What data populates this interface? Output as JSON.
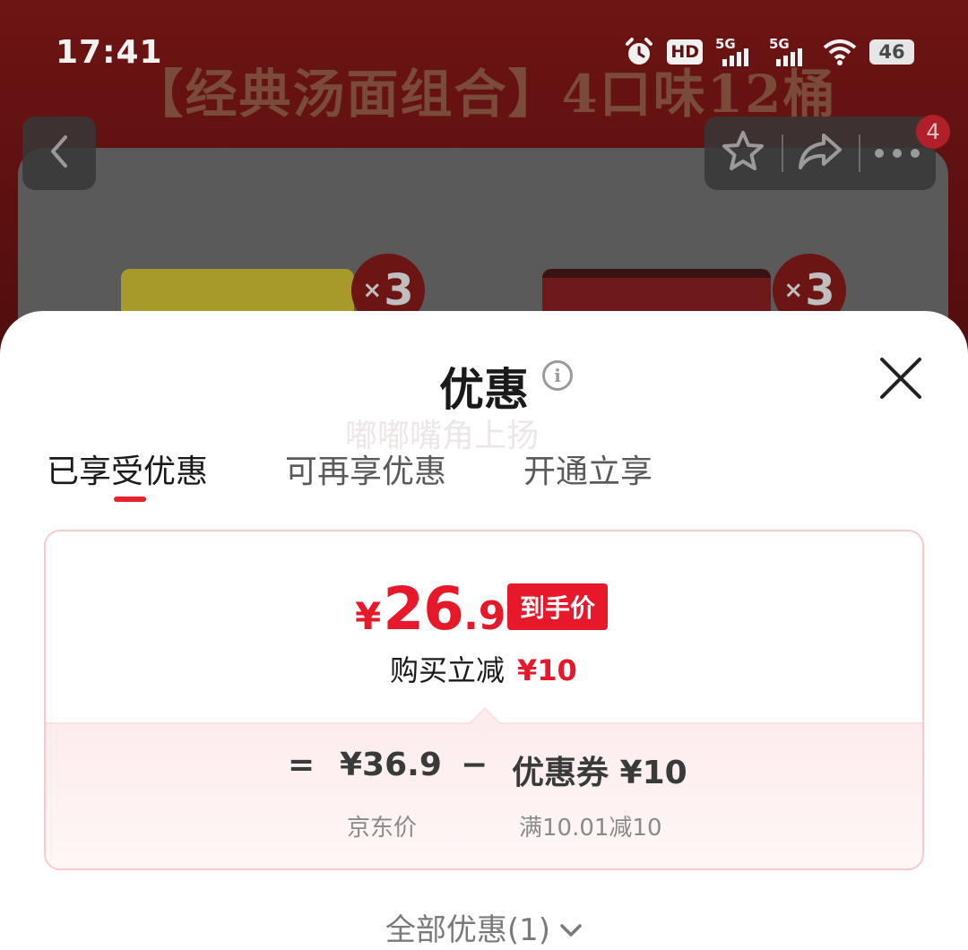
{
  "status_bar": {
    "time": "17:41",
    "hd": "HD",
    "sim1": "5G",
    "sim2": "5G",
    "battery": "46"
  },
  "background": {
    "banner_title": "【经典汤面组合】4口味12桶",
    "qty_1": "3",
    "qty_2": "3",
    "qty_prefix": "×",
    "notification_count": "4"
  },
  "sheet": {
    "title": "优惠",
    "watermark": "嘟嘟嘴角上扬",
    "tabs": [
      {
        "label": "已享受优惠",
        "active": true
      },
      {
        "label": "可再享优惠",
        "active": false
      },
      {
        "label": "开通立享",
        "active": false
      }
    ],
    "price": {
      "currency": "¥",
      "final_int": "26",
      "final_dec": ".9",
      "final_tag": "到手价",
      "instant_label": "购买立减",
      "instant_amount": "¥10"
    },
    "calc": {
      "equals": "=",
      "jd_price": "¥36.9",
      "minus": "−",
      "coupon": "优惠券 ¥10",
      "jd_label": "京东价",
      "coupon_condition": "满10.01减10"
    },
    "all_offers": "全部优惠(1)"
  },
  "colors": {
    "accent_red": "#e8182b",
    "card_border": "#f9c9cf"
  },
  "icons": [
    "alarm-icon",
    "wifi-icon",
    "back-icon",
    "star-icon",
    "share-icon",
    "more-icon",
    "info-icon",
    "close-icon",
    "chevron-down-icon"
  ]
}
